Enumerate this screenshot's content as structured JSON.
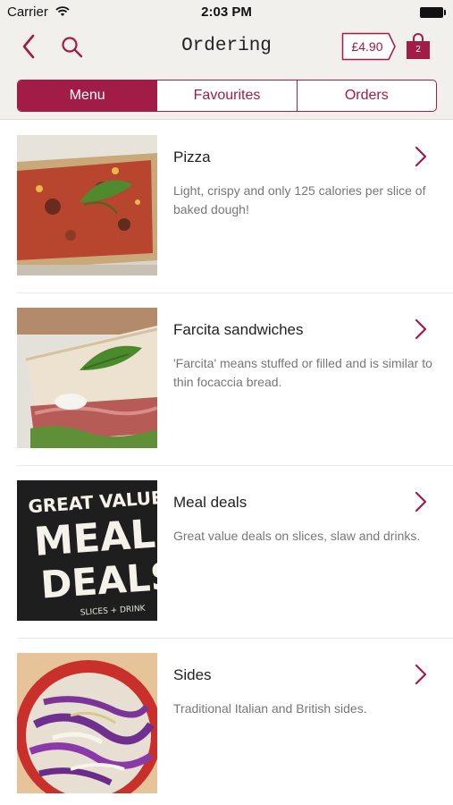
{
  "status_bar": {
    "carrier": "Carrier",
    "time": "2:03 PM"
  },
  "header": {
    "title": "Ordering",
    "basket_total": "£4.90",
    "basket_count": "2",
    "accent_color": "#a11c47",
    "icons": [
      "back-chevron-icon",
      "search-icon",
      "price-tag-icon",
      "shopping-bag-icon"
    ]
  },
  "tabs": [
    {
      "label": "Menu",
      "active": true
    },
    {
      "label": "Favourites",
      "active": false
    },
    {
      "label": "Orders",
      "active": false
    }
  ],
  "menu": [
    {
      "title": "Pizza",
      "description": "Light, crispy and only 125 calories per slice of baked dough!",
      "image": "pizza-slice-photo"
    },
    {
      "title": "Farcita sandwiches",
      "description": "'Farcita' means stuffed or filled and is similar to thin focaccia bread.",
      "image": "farcita-sandwich-photo"
    },
    {
      "title": "Meal deals",
      "description": "Great value deals on slices, slaw and drinks.",
      "image": "meal-deals-chalkboard",
      "image_text": {
        "line1": "GREAT VALUE",
        "line2": "MEAL",
        "line3": "DEALS",
        "line4": "SLICES + DRINK"
      }
    },
    {
      "title": "Sides",
      "description": "Traditional Italian and British sides.",
      "image": "coleslaw-bowl-photo"
    }
  ]
}
